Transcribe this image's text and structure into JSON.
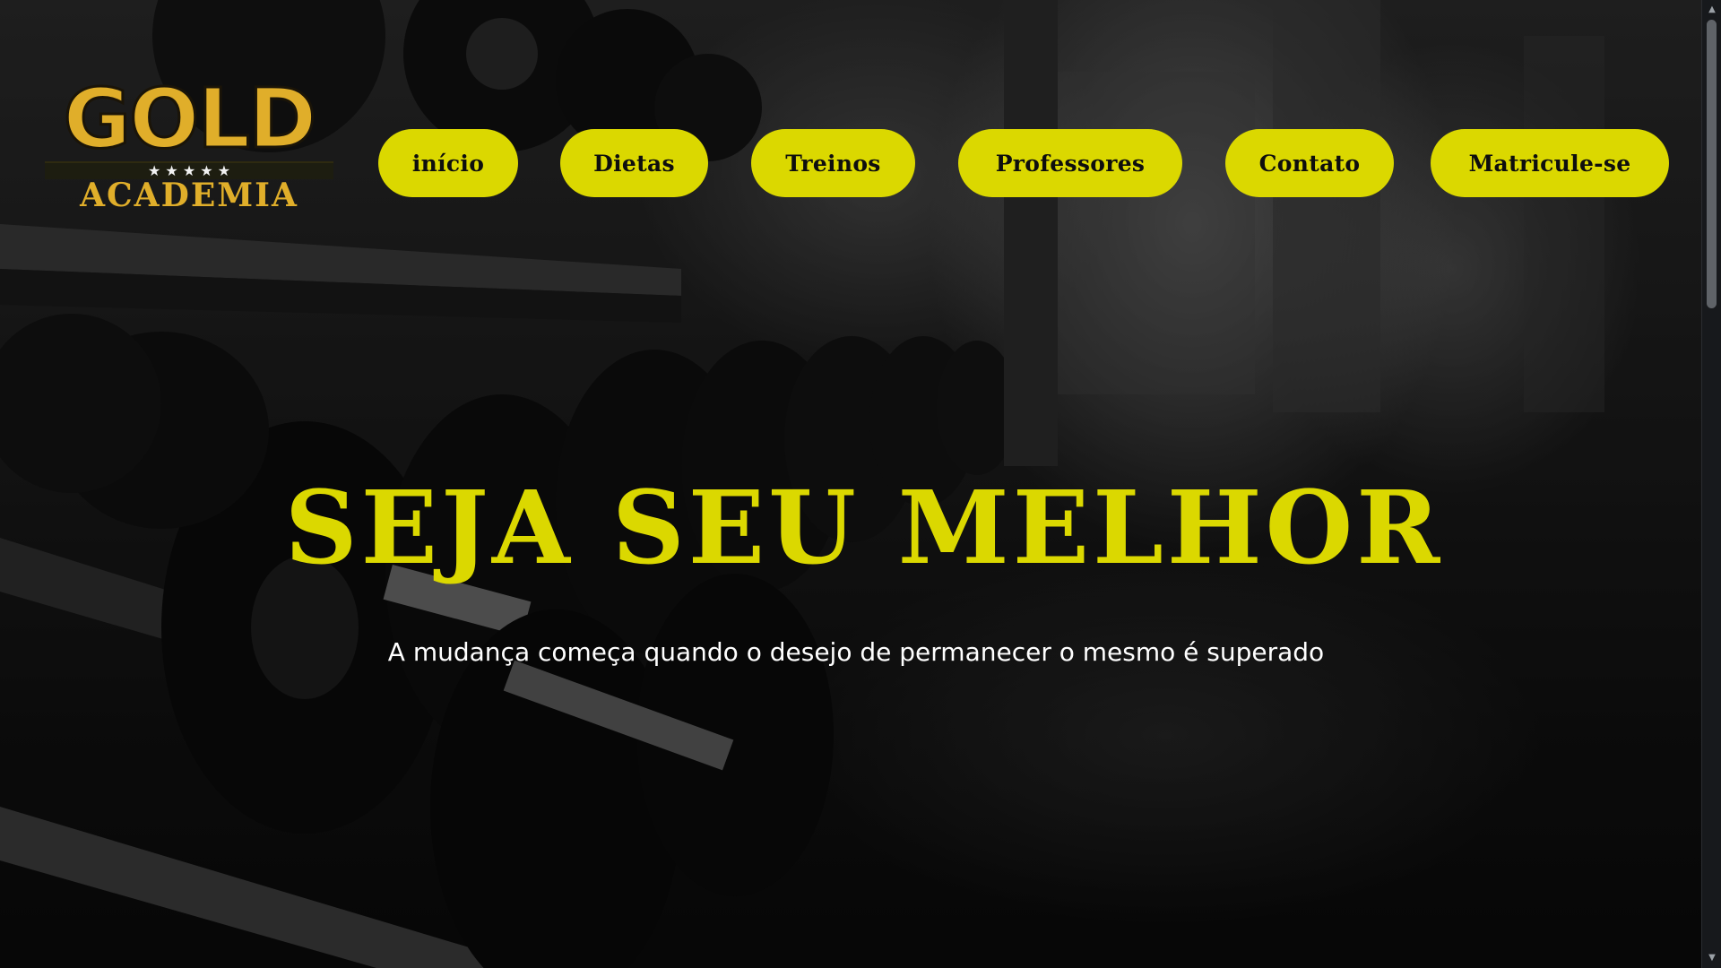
{
  "logo": {
    "word": "GOLD",
    "stars": "★ ★ ★ ★ ★",
    "sub": "ACADEMIA"
  },
  "nav": {
    "items": [
      {
        "label": "início"
      },
      {
        "label": "Dietas"
      },
      {
        "label": "Treinos"
      },
      {
        "label": "Professores"
      },
      {
        "label": "Contato"
      },
      {
        "label": "Matricule-se"
      }
    ]
  },
  "hero": {
    "title": "SEJA SEU MELHOR",
    "subtitle": "A mudança começa quando o desejo de permanecer o mesmo é superado"
  },
  "colors": {
    "accent": "#dbd800",
    "logo_gold": "#e0ae2a",
    "background": "#111111"
  },
  "scrollbar": {
    "up_icon": "chevron-up-icon",
    "down_icon": "chevron-down-icon"
  }
}
